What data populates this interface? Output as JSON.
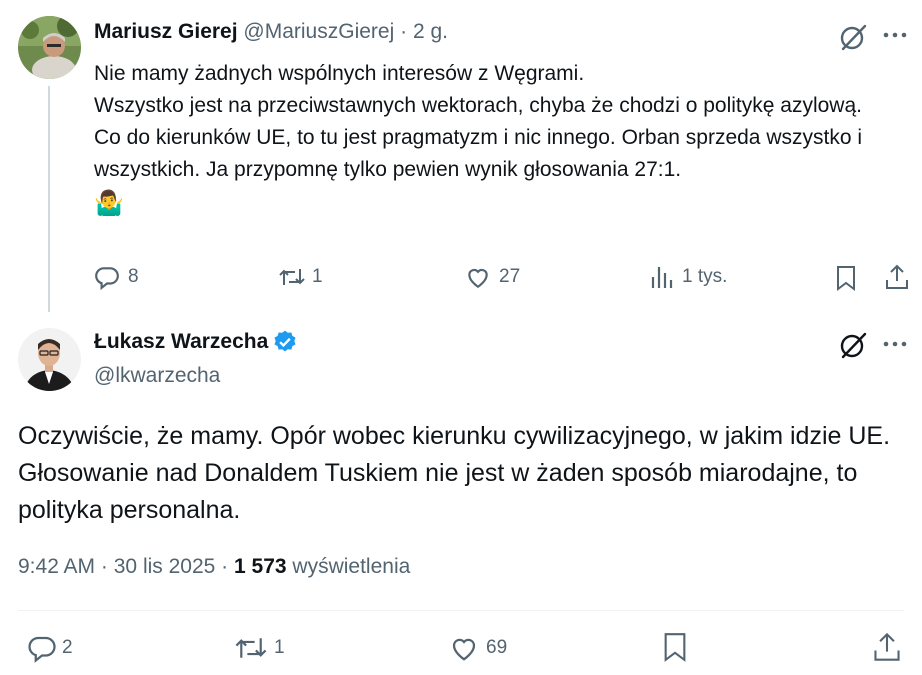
{
  "reply_tweet": {
    "author_name": "Mariusz Gierej",
    "handle": "@MariuszGierej",
    "separator": "·",
    "time": "2 g.",
    "lines": [
      "Nie mamy żadnych wspólnych interesów z Węgrami.",
      "Wszystko jest na przeciwstawnych wektorach, chyba że chodzi o politykę azylową.",
      "Co do kierunków UE, to tu jest pragmatyzm i nic innego. Orban sprzeda wszystko i wszystkich. Ja przypomnę tylko pewien wynik głosowania 27:1."
    ],
    "emoji": "🤷‍♂️",
    "actions": {
      "replies": "8",
      "reposts": "1",
      "likes": "27",
      "views": "1 tys."
    }
  },
  "main_tweet": {
    "author_name": "Łukasz Warzecha",
    "handle": "@lkwarzecha",
    "verified": true,
    "text": "Oczywiście, że mamy. Opór wobec kierunku cywilizacyjnego, w jakim idzie UE. Głosowanie nad Donaldem Tuskiem nie jest w żaden sposób miarodajne, to polityka personalna.",
    "time": "9:42 AM",
    "separator": "·",
    "date": "30 lis 2025",
    "separator2": "·",
    "views_count": "1 573",
    "views_label": "wyświetlenia",
    "actions": {
      "replies": "2",
      "reposts": "1",
      "likes": "69"
    }
  },
  "colors": {
    "text": "#0f1419",
    "muted": "#536471",
    "verified": "#1d9bf0",
    "line": "#cfd9de"
  },
  "icons": [
    "grok-icon",
    "more-icon",
    "reply-icon",
    "repost-icon",
    "like-icon",
    "views-icon",
    "bookmark-icon",
    "share-icon",
    "verified-badge-icon"
  ]
}
